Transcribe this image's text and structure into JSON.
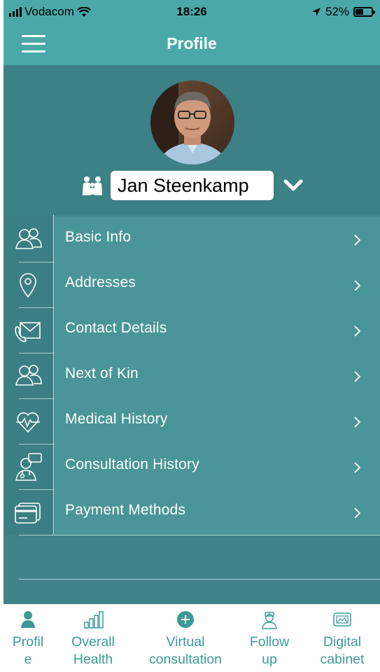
{
  "status_bar": {
    "carrier": "Vodacom",
    "time": "18:26",
    "battery": "52%",
    "battery_level": 0.52
  },
  "header": {
    "title": "Profile"
  },
  "profile": {
    "name": "Jan Steenkamp"
  },
  "menu": {
    "items": [
      {
        "label": "Basic Info",
        "icon": "people-icon"
      },
      {
        "label": "Addresses",
        "icon": "location-pin-icon"
      },
      {
        "label": "Contact Details",
        "icon": "envelope-phone-icon"
      },
      {
        "label": "Next of Kin",
        "icon": "people-icon"
      },
      {
        "label": "Medical History",
        "icon": "heart-pulse-icon"
      },
      {
        "label": "Consultation History",
        "icon": "doctor-icon"
      },
      {
        "label": "Payment Methods",
        "icon": "credit-card-icon"
      }
    ]
  },
  "tabs": [
    {
      "line1": "Profil",
      "line2": "e",
      "icon": "person-icon"
    },
    {
      "line1": "Overall",
      "line2": "Health",
      "icon": "bar-chart-icon"
    },
    {
      "line1": "Virtual",
      "line2": "consultation",
      "icon": "plus-circle-icon"
    },
    {
      "line1": "Follow",
      "line2": "up",
      "icon": "nurse-icon"
    },
    {
      "line1": "Digital",
      "line2": "cabinet",
      "icon": "image-folder-icon"
    }
  ],
  "colors": {
    "header": "#4aa9a8",
    "profile_bg": "#3c8185",
    "list_row": "#4a9597",
    "tab_accent": "#3c9b98"
  }
}
